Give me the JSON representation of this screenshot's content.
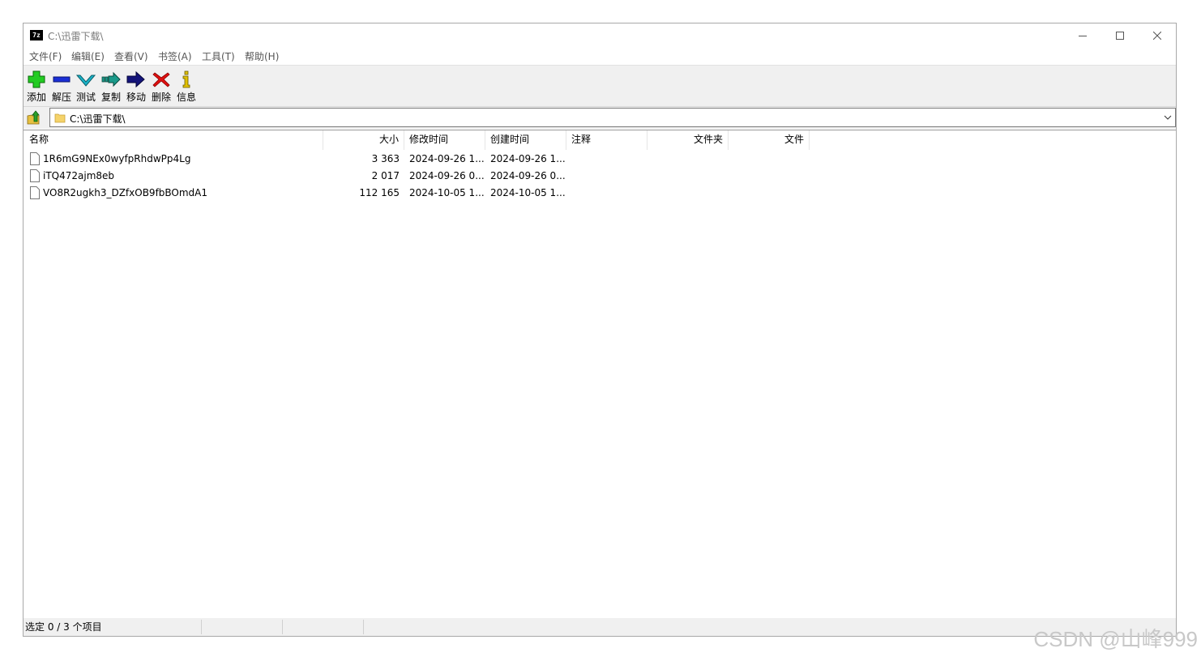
{
  "window": {
    "title": "C:\\迅雷下载\\",
    "app_icon_text": "7z"
  },
  "menu": [
    {
      "label": "文件(F)"
    },
    {
      "label": "编辑(E)"
    },
    {
      "label": "查看(V)"
    },
    {
      "label": "书签(A)"
    },
    {
      "label": "工具(T)"
    },
    {
      "label": "帮助(H)"
    }
  ],
  "toolbar": {
    "add": "添加",
    "extract": "解压",
    "test": "测试",
    "copy": "复制",
    "move": "移动",
    "delete": "删除",
    "info": "信息"
  },
  "address": {
    "path": "C:\\迅雷下载\\"
  },
  "columns": {
    "name": "名称",
    "size": "大小",
    "modified": "修改时间",
    "created": "创建时间",
    "comment": "注释",
    "folders": "文件夹",
    "files": "文件"
  },
  "files": [
    {
      "name": "1R6mG9NEx0wyfpRhdwPp4Lg",
      "size": "3 363",
      "modified": "2024-09-26 1...",
      "created": "2024-09-26 1..."
    },
    {
      "name": "iTQ472ajm8eb",
      "size": "2 017",
      "modified": "2024-09-26 0...",
      "created": "2024-09-26 0..."
    },
    {
      "name": "VO8R2ugkh3_DZfxOB9fbBOmdA1",
      "size": "112 165",
      "modified": "2024-10-05 1...",
      "created": "2024-10-05 1..."
    }
  ],
  "status": {
    "selection": "选定 0 / 3 个项目"
  },
  "watermark": "CSDN @山峰999",
  "colors": {
    "toolbar_bg": "#f0f0f0",
    "add_icon": "#22cc22",
    "extract_icon": "#1a2fd6",
    "test_icon": "#1ab3c9",
    "copy_icon": "#1a9a8a",
    "move_icon": "#14147a",
    "delete_icon": "#e01010",
    "info_icon": "#e0c000"
  }
}
